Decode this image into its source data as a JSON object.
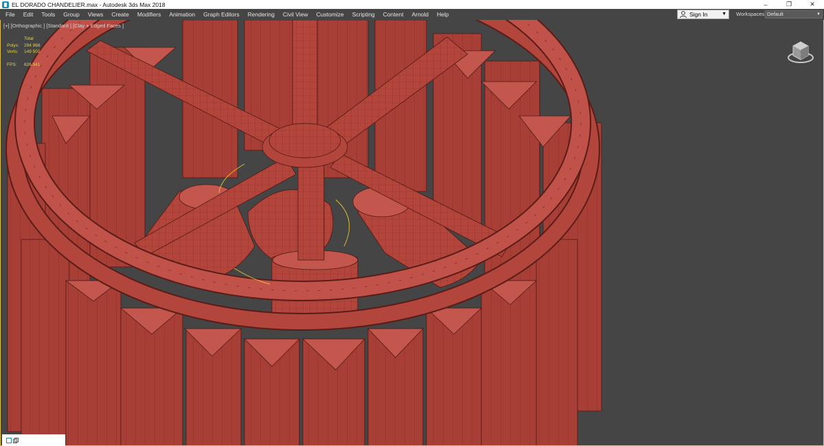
{
  "window": {
    "title": "EL DORADO CHANDELIER.max - Autodesk 3ds Max 2018",
    "minimize_glyph": "–",
    "maximize_glyph": "❐",
    "close_glyph": "✕"
  },
  "menu": {
    "items": [
      "File",
      "Edit",
      "Tools",
      "Group",
      "Views",
      "Create",
      "Modifiers",
      "Animation",
      "Graph Editors",
      "Rendering",
      "Civil View",
      "Customize",
      "Scripting",
      "Content",
      "Arnold",
      "Help"
    ]
  },
  "account": {
    "sign_in_label": "Sign In",
    "workspaces_label": "Workspaces:",
    "workspace_value": "Default"
  },
  "viewport": {
    "label": "[+] [Orthographic ] [Standard ] [Clay + Edged Faces ]",
    "stats": {
      "total_label": "Total",
      "polys_label": "Polys:",
      "polys_value": "294 968",
      "verts_label": "Verts:",
      "verts_value": "149 502",
      "fps_label": "FPS:",
      "fps_value": "626.941"
    },
    "accent_color": "#e4c54a",
    "model_color": "#b2453c"
  }
}
